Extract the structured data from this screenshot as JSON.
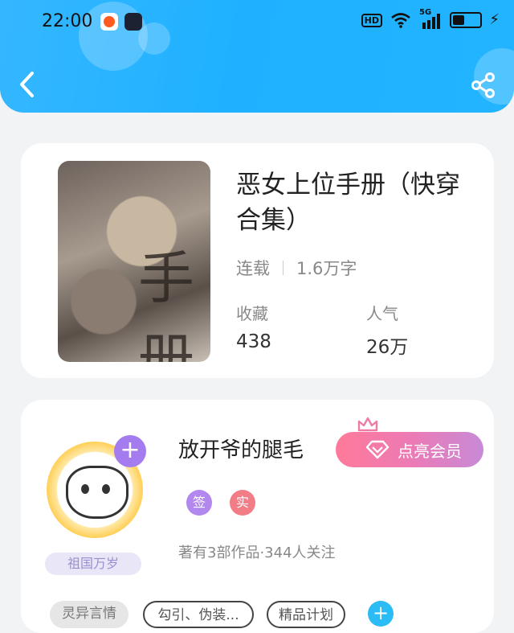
{
  "status_bar": {
    "time": "22:00",
    "network_label": "HD",
    "signal_label": "5G",
    "battery_fraction": 0.4
  },
  "header": {
    "back_icon": "chevron-left-icon",
    "share_icon": "share-icon",
    "color": "#22b4ff"
  },
  "book": {
    "title": "恶女上位手册（快穿合集）",
    "status": "连载",
    "word_count": "1.6万字",
    "favorites_label": "收藏",
    "favorites_value": "438",
    "popularity_label": "人气",
    "popularity_value": "26万"
  },
  "author": {
    "name": "放开爷的腿毛",
    "vip_label": "点亮会员",
    "badge_sign": "签",
    "badge_real": "实",
    "meta": "著有3部作品·344人关注",
    "medal": "祖国万岁",
    "tags": [
      "灵异言情",
      "勾引、伪装...",
      "精品计划"
    ],
    "colors": {
      "sign": "#b287ee",
      "real": "#f37d86",
      "vip": "#ec7ab4"
    }
  }
}
